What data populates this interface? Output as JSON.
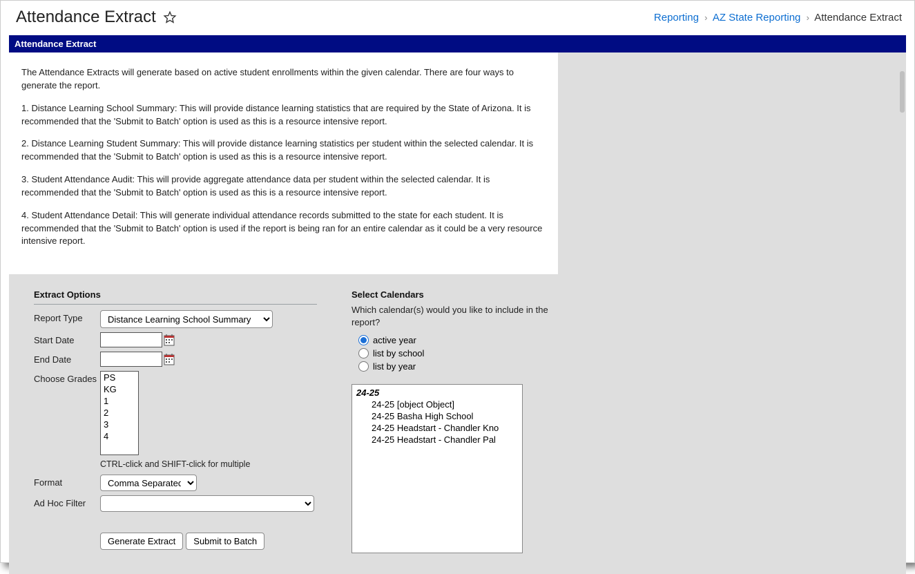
{
  "header": {
    "title": "Attendance Extract"
  },
  "breadcrumb": {
    "items": [
      {
        "label": "Reporting",
        "link": true
      },
      {
        "label": "AZ State Reporting",
        "link": true
      },
      {
        "label": "Attendance Extract",
        "link": false
      }
    ]
  },
  "panel": {
    "title": "Attendance Extract"
  },
  "description": {
    "intro": "The Attendance Extracts will generate based on active student enrollments within the given calendar. There are four ways to generate the report.",
    "p1": "1. Distance Learning School Summary: This will provide distance learning statistics that are required by the State of Arizona. It is recommended that the 'Submit to Batch' option is used as this is a resource intensive report.",
    "p2": "2. Distance Learning Student Summary: This will provide distance learning statistics per student within the selected calendar. It is recommended that the 'Submit to Batch' option is used as this is a resource intensive report.",
    "p3": "3. Student Attendance Audit: This will provide aggregate attendance data per student within the selected calendar. It is recommended that the 'Submit to Batch' option is used as this is a resource intensive report.",
    "p4": "4. Student Attendance Detail: This will generate individual attendance records submitted to the state for each student. It is recommended that the 'Submit to Batch' option is used if the report is being ran for an entire calendar as it could be a very resource intensive report."
  },
  "extract": {
    "section_title": "Extract Options",
    "report_type_label": "Report Type",
    "report_type_value": "Distance Learning School Summary",
    "start_date_label": "Start Date",
    "start_date_value": "",
    "end_date_label": "End Date",
    "end_date_value": "",
    "grades_label": "Choose Grades",
    "grades": [
      "PS",
      "KG",
      "1",
      "2",
      "3",
      "4"
    ],
    "grades_hint": "CTRL-click and SHIFT-click for multiple",
    "format_label": "Format",
    "format_value": "Comma Separated",
    "adhoc_label": "Ad Hoc Filter",
    "adhoc_value": "",
    "generate_label": "Generate Extract",
    "submit_label": "Submit to Batch"
  },
  "calendars": {
    "section_title": "Select Calendars",
    "question": "Which calendar(s) would you like to include in the report?",
    "options": {
      "active": "active year",
      "school": "list by school",
      "year": "list by year"
    },
    "tree_root": "24-25",
    "tree_children": [
      "24-25 [object Object]",
      "24-25 Basha High School",
      "24-25 Headstart - Chandler Kno",
      "24-25 Headstart - Chandler Pal"
    ]
  }
}
